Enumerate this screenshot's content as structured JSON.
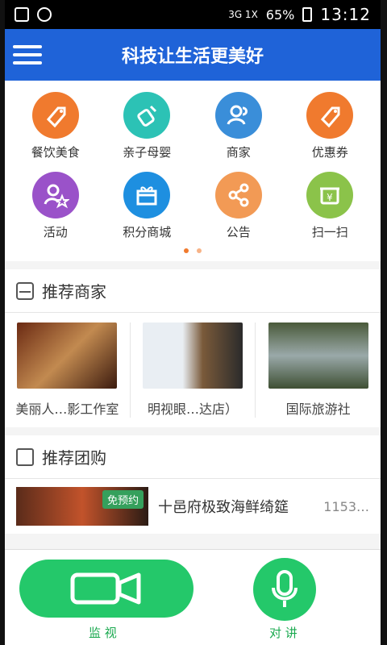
{
  "statusbar": {
    "network": "3G 1X",
    "battery": "65%",
    "time": "13:12"
  },
  "header": {
    "title": "科技让生活更美好"
  },
  "categories": [
    {
      "label": "餐饮美食",
      "icon": "tag-icon",
      "color": "#f07a2e"
    },
    {
      "label": "亲子母婴",
      "icon": "baby-bottle-icon",
      "color": "#2cc2b5"
    },
    {
      "label": "商家",
      "icon": "users-icon",
      "color": "#3a8ed9"
    },
    {
      "label": "优惠券",
      "icon": "coupon-tag-icon",
      "color": "#f07a2e"
    },
    {
      "label": "活动",
      "icon": "user-star-icon",
      "color": "#9a52c9"
    },
    {
      "label": "积分商城",
      "icon": "gift-icon",
      "color": "#1e8fe0"
    },
    {
      "label": "公告",
      "icon": "share-icon",
      "color": "#f29a55"
    },
    {
      "label": "扫一扫",
      "icon": "scan-yen-icon",
      "color": "#8bc34a"
    }
  ],
  "pager": {
    "active_color": "#f07a2e",
    "inactive_color": "#f7b387"
  },
  "sections": {
    "merchants_title": "推荐商家",
    "group_title": "推荐团购"
  },
  "merchants": [
    {
      "name": "美丽人…影工作室"
    },
    {
      "name": "明视眼…达店）"
    },
    {
      "name": "国际旅游社"
    }
  ],
  "group_buy": {
    "badge": "免预约",
    "name": "十邑府极致海鲜绮筵",
    "count": "1153…"
  },
  "bottom": {
    "monitor_label": "监 视",
    "talk_label": "对 讲"
  },
  "colors": {
    "header_blue": "#1f63d8",
    "action_green": "#24c86a"
  }
}
